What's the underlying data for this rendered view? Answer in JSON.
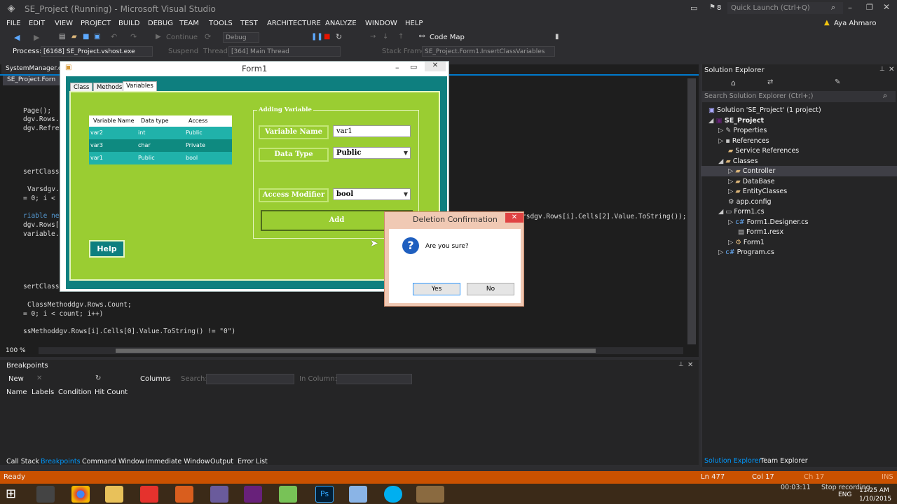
{
  "window": {
    "title": "SE_Project (Running) - Microsoft Visual Studio",
    "notifications": "8",
    "quick_launch_placeholder": "Quick Launch (Ctrl+Q)",
    "user": "Aya Ahmaro"
  },
  "menu": [
    "FILE",
    "EDIT",
    "VIEW",
    "PROJECT",
    "BUILD",
    "DEBUG",
    "TEAM",
    "TOOLS",
    "TEST",
    "ARCHITECTURE",
    "ANALYZE",
    "WINDOW",
    "HELP"
  ],
  "toolbar": {
    "continue": "Continue",
    "config": "Debug",
    "code_map": "Code Map"
  },
  "debugbar": {
    "process_label": "Process:",
    "process_value": "[6168] SE_Project.vshost.exe",
    "suspend": "Suspend",
    "thread_label": "Thread:",
    "thread_value": "[364] Main Thread",
    "stack_label": "Stack Frame:",
    "stack_value": "SE_Project.Form1.InsertClassVariables"
  },
  "editor": {
    "tab1": "SystemManager.c",
    "tab2": "SE_Project.Forn",
    "zoom": "100 %",
    "lines": [
      "Page();",
      "dgv.Rows.",
      "dgv.Refre",
      "sertClass",
      "Varsdgv.",
      "= 0; i <",
      "riable ne",
      "dgv.Rows[",
      "variable.",
      "sertClass",
      "ClassMethoddgv.Rows.Count;",
      "= 0; i < count; i++)",
      "ssMethoddgv.Rows[i].Cells[0].Value.ToString() != \"0\")"
    ],
    "right_line": "rsdgv.Rows[i].Cells[2].Value.ToString());"
  },
  "form1": {
    "title": "Form1",
    "tabs": [
      "Class",
      "Methods",
      "Variables"
    ],
    "grid_headers": [
      "Variable Name",
      "Data type",
      "Access"
    ],
    "grid_rows": [
      [
        "var2",
        "int",
        "Public"
      ],
      [
        "var3",
        "char",
        "Private"
      ],
      [
        "var1",
        "Public",
        "bool"
      ]
    ],
    "group_title": "Adding Variable",
    "var_name_label": "Variable Name",
    "var_name_value": "var1",
    "data_type_label": "Data Type",
    "data_type_value": "Public",
    "access_label": "Access Modifier",
    "access_value": "bool",
    "add_button": "Add",
    "help_button": "Help"
  },
  "dialog": {
    "title": "Deletion Confirmation",
    "message": "Are you sure?",
    "yes": "Yes",
    "no": "No"
  },
  "solution": {
    "title": "Solution Explorer",
    "search_placeholder": "Search Solution Explorer (Ctrl+;)",
    "items": [
      "Solution 'SE_Project' (1 project)",
      "SE_Project",
      "Properties",
      "References",
      "Service References",
      "Classes",
      "Controller",
      "DataBase",
      "EntityClasses",
      "app.config",
      "Form1.cs",
      "Form1.Designer.cs",
      "Form1.resx",
      "Form1",
      "Program.cs"
    ],
    "bottom_tabs": [
      "Solution Explorer",
      "Team Explorer"
    ]
  },
  "breakpoints": {
    "title": "Breakpoints",
    "new": "New",
    "columns": "Columns",
    "search_label": "Search:",
    "in_column": "In Column:",
    "headers": [
      "Name",
      "Labels",
      "Condition",
      "Hit Count"
    ]
  },
  "bottom_tabs": [
    "Call Stack",
    "Breakpoints",
    "Command Window",
    "Immediate Window",
    "Output",
    "Error List"
  ],
  "status": {
    "ready": "Ready",
    "ln": "Ln 477",
    "col": "Col 17",
    "ch": "Ch 17",
    "ins": "INS"
  },
  "taskbar": {
    "rec_time": "00:03:11",
    "stop_rec": "Stop recording",
    "lang": "ENG",
    "time": "11:25 AM",
    "date": "1/10/2015"
  },
  "colors": {
    "vs_bg": "#2d2d30",
    "status": "#ca5100",
    "form_teal": "#0e7f7f",
    "form_green": "#9acd32",
    "grid_row": "#20b2aa"
  }
}
